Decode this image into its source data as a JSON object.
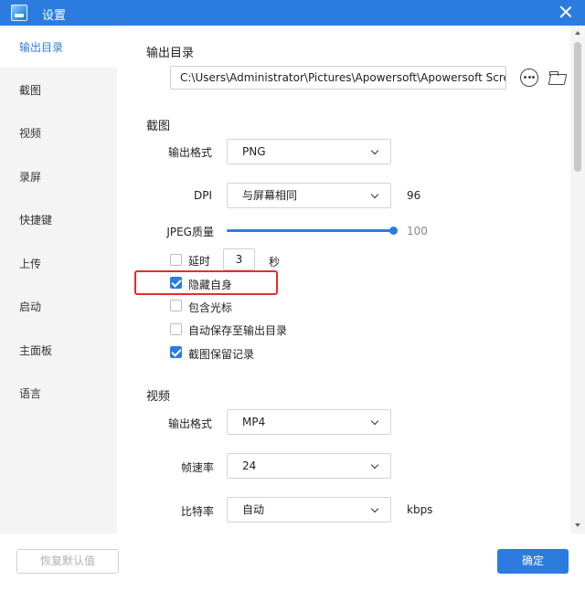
{
  "window": {
    "title": "设置",
    "accent_color": "#2c7ce0",
    "icons": {
      "app": "app-logo-icon",
      "close": "close-icon"
    }
  },
  "sidebar": {
    "items": [
      {
        "label": "输出目录",
        "active": true
      },
      {
        "label": "截图",
        "active": false
      },
      {
        "label": "视频",
        "active": false
      },
      {
        "label": "录屏",
        "active": false
      },
      {
        "label": "快捷键",
        "active": false
      },
      {
        "label": "上传",
        "active": false
      },
      {
        "label": "启动",
        "active": false
      },
      {
        "label": "主面板",
        "active": false
      },
      {
        "label": "语言",
        "active": false
      }
    ]
  },
  "output": {
    "title": "输出目录",
    "path": "C:\\Users\\Administrator\\Pictures\\Apowersoft\\Apowersoft Screen",
    "icons": {
      "more": "more-options-icon",
      "browse": "folder-icon"
    }
  },
  "screenshot": {
    "title": "截图",
    "format_label": "输出格式",
    "format_value": "PNG",
    "dpi_label": "DPI",
    "dpi_value": "与屏幕相同",
    "dpi_number": "96",
    "jpeg_label": "JPEG质量",
    "jpeg_quality": 100,
    "jpeg_quality_text": "100",
    "delay_label": "延时",
    "delay_value": "3",
    "delay_unit": "秒",
    "options": [
      {
        "label": "延时",
        "checked": false
      },
      {
        "label": "隐藏自身",
        "checked": true
      },
      {
        "label": "包含光标",
        "checked": false
      },
      {
        "label": "自动保存至输出目录",
        "checked": false
      },
      {
        "label": "截图保留记录",
        "checked": true
      }
    ]
  },
  "video": {
    "title": "视频",
    "format_label": "输出格式",
    "format_value": "MP4",
    "fps_label": "帧速率",
    "fps_value": "24",
    "bitrate_label": "比特率",
    "bitrate_value": "自动",
    "bitrate_unit": "kbps"
  },
  "footer": {
    "reset_label": "恢复默认值",
    "ok_label": "确定"
  }
}
